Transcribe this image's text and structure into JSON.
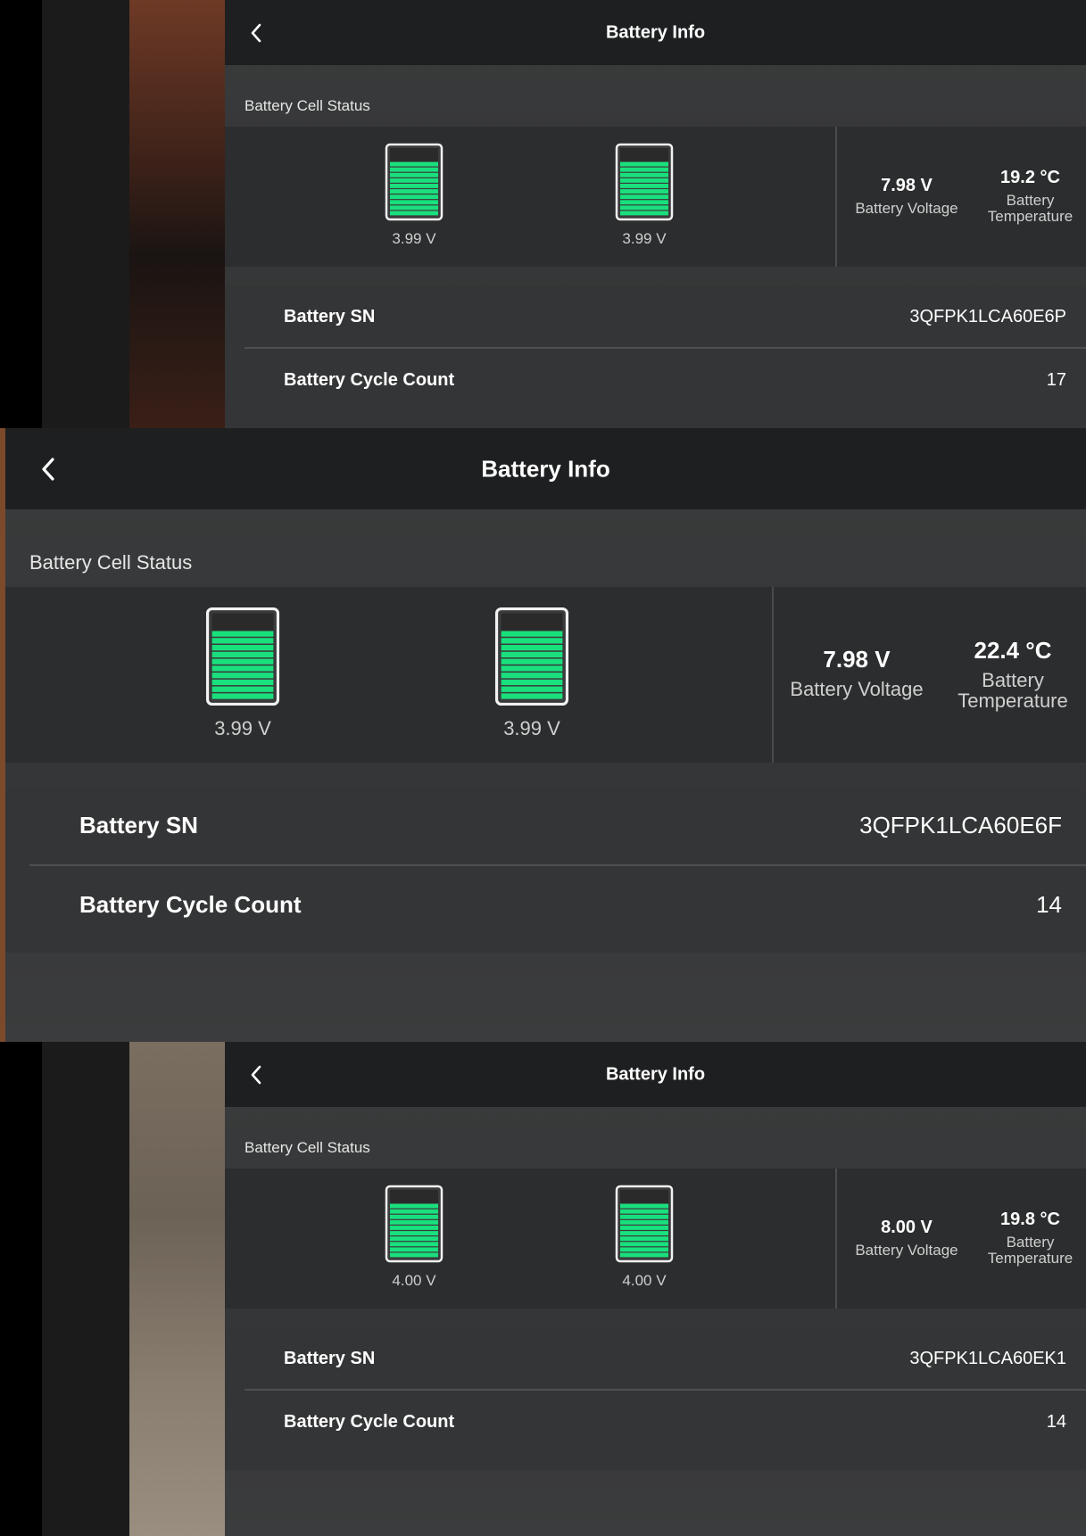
{
  "colors": {
    "cell_fill": "#19e07d",
    "topbar": "#1e1f20",
    "panel": "#393a3b"
  },
  "icons": {
    "back": "chevron-left-icon",
    "cell": "battery-cell-icon"
  },
  "screens": [
    {
      "header": {
        "title": "Battery Info"
      },
      "cell_status": {
        "label": "Battery Cell Status",
        "cells": [
          {
            "voltage": "3.99 V",
            "level": 1.0
          },
          {
            "voltage": "3.99 V",
            "level": 1.0
          }
        ]
      },
      "stats": {
        "voltage": {
          "value": "7.98 V",
          "label": "Battery Voltage"
        },
        "temperature": {
          "value": "19.2 °C",
          "label": "Battery Temperature"
        }
      },
      "info": [
        {
          "label": "Battery SN",
          "value": "3QFPK1LCA60E6P"
        },
        {
          "label": "Battery Cycle Count",
          "value": "17"
        }
      ]
    },
    {
      "header": {
        "title": "Battery Info"
      },
      "cell_status": {
        "label": "Battery Cell Status",
        "cells": [
          {
            "voltage": "3.99 V",
            "level": 1.0
          },
          {
            "voltage": "3.99 V",
            "level": 1.0
          }
        ]
      },
      "stats": {
        "voltage": {
          "value": "7.98 V",
          "label": "Battery Voltage"
        },
        "temperature": {
          "value": "22.4 °C",
          "label": "Battery Temperature"
        }
      },
      "info": [
        {
          "label": "Battery SN",
          "value": "3QFPK1LCA60E6F"
        },
        {
          "label": "Battery Cycle Count",
          "value": "14"
        }
      ]
    },
    {
      "header": {
        "title": "Battery Info"
      },
      "cell_status": {
        "label": "Battery Cell Status",
        "cells": [
          {
            "voltage": "4.00 V",
            "level": 1.0
          },
          {
            "voltage": "4.00 V",
            "level": 1.0
          }
        ]
      },
      "stats": {
        "voltage": {
          "value": "8.00 V",
          "label": "Battery Voltage"
        },
        "temperature": {
          "value": "19.8 °C",
          "label": "Battery Temperature"
        }
      },
      "info": [
        {
          "label": "Battery SN",
          "value": "3QFPK1LCA60EK1"
        },
        {
          "label": "Battery Cycle Count",
          "value": "14"
        }
      ]
    }
  ]
}
